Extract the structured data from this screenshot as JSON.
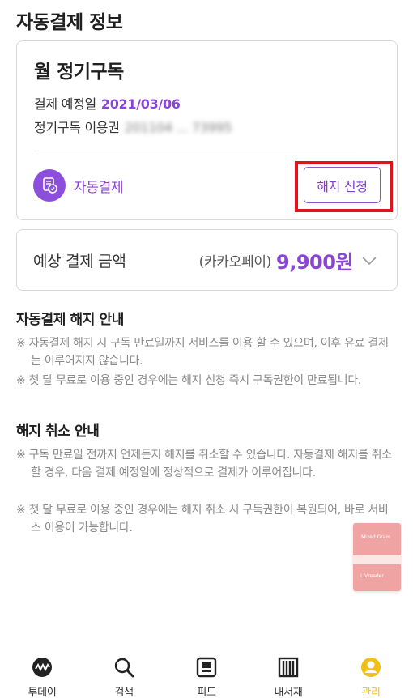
{
  "page": {
    "title": "자동결제 정보"
  },
  "subscription": {
    "plan_name": "월 정기구독",
    "payment_date_label": "결제 예정일",
    "payment_date_value": "2021/03/06",
    "ticket_label": "정기구독 이용권",
    "ticket_value": "201104 ... 73995",
    "auto_payment_label": "자동결제",
    "cancel_button_label": "해지 신청"
  },
  "price": {
    "label": "예상 결제 금액",
    "method": "(카카오페이)",
    "amount": "9,900원"
  },
  "sections": [
    {
      "title": "자동결제 해지 안내",
      "notices": [
        "※ 자동결제 해지 시 구독 만료일까지 서비스를 이용 할 수 있으며, 이후 유료 결제는 이루어지지 않습니다.",
        "※ 첫 달 무료로 이용 중인 경우에는 해지 신청 즉시 구독권한이 만료됩니다."
      ]
    },
    {
      "title": "해지 취소 안내",
      "notices": [
        "※ 구독 만료일 전까지 언제든지 해지를 취소할 수 있습니다. 자동결제 해지를 취소할 경우, 다음 결제 예정일에 정상적으로 결제가 이루어집니다.",
        "※ 첫 달 무료로 이용 중인 경우에는 해지 취소 시 구독권한이 복원되어, 바로 서비스 이용이 가능합니다."
      ]
    }
  ],
  "thumbnail": {
    "line1": "Mixed Grain",
    "line2": "LIVreader"
  },
  "bottom_nav": [
    {
      "label": "투데이",
      "icon": "today-icon"
    },
    {
      "label": "검색",
      "icon": "search-icon"
    },
    {
      "label": "피드",
      "icon": "feed-icon"
    },
    {
      "label": "내서재",
      "icon": "library-icon"
    },
    {
      "label": "관리",
      "icon": "profile-icon",
      "active": true
    }
  ],
  "colors": {
    "accent": "#8a44d6",
    "active_nav": "#f0c018",
    "highlight": "#e0141d",
    "thumbnail_bg": "#f0a3a3"
  }
}
